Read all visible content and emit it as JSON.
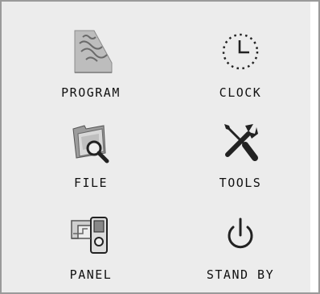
{
  "menu": {
    "program": {
      "label": "PROGRAM",
      "icon": "program-icon"
    },
    "clock": {
      "label": "CLOCK",
      "icon": "clock-icon"
    },
    "file": {
      "label": "FILE",
      "icon": "file-folder-icon"
    },
    "tools": {
      "label": "TOOLS",
      "icon": "tools-icon"
    },
    "panel": {
      "label": "PANEL",
      "icon": "panel-device-icon"
    },
    "standby": {
      "label": "STAND BY",
      "icon": "power-icon"
    }
  },
  "colors": {
    "background": "#ececec",
    "border": "#9a9a9a",
    "text": "#111111",
    "icon_dark": "#222222",
    "icon_gray": "#8a8a8a"
  }
}
